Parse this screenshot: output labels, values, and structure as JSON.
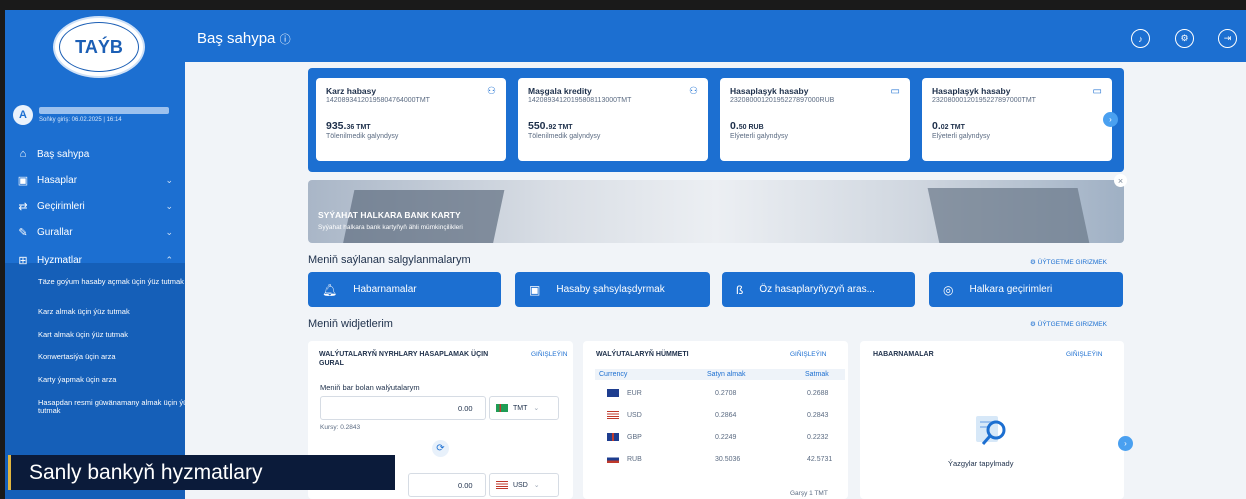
{
  "logo": {
    "text": "TAÝB"
  },
  "user": {
    "avatar_letter": "A",
    "last_login": "Soňky giriş: 06.02.2025 | 16:14"
  },
  "sidebar": {
    "items": [
      {
        "label": "Baş sahypa",
        "icon": "home-icon"
      },
      {
        "label": "Hasaplar",
        "icon": "wallet-icon"
      },
      {
        "label": "Geçirimleri",
        "icon": "transfer-icon"
      },
      {
        "label": "Gurallar",
        "icon": "tools-icon"
      },
      {
        "label": "Hyzmatlar",
        "icon": "grid-icon"
      }
    ],
    "services_submenu": [
      "Täze goýum hasaby açmak üçin ýüz tutmak",
      "Karz almak üçin ýüz tutmak",
      "Kart almak üçin ýüz tutmak",
      "Konwertasiýa üçin arza",
      "Karty ýapmak üçin arza",
      "Hasapdan resmi güwänamany almak üçin ýüz tutmak"
    ]
  },
  "header": {
    "title": "Baş sahypa",
    "icons": [
      "bell-icon",
      "settings-icon",
      "logout-icon"
    ]
  },
  "accounts": [
    {
      "title": "Karz habasy",
      "number": "14208934120195804764000TMT",
      "amount_main": "935.",
      "amount_dec": "36 TMT",
      "subtitle": "Tölenilmedik galyndysy"
    },
    {
      "title": "Maşgala kredity",
      "number": "14208934120195808113000TMT",
      "amount_main": "550.",
      "amount_dec": "92 TMT",
      "subtitle": "Tölenilmedik galyndysy"
    },
    {
      "title": "Hasaplaşyk hasaby",
      "number": "23208000120195227897000RUB",
      "amount_main": "0.",
      "amount_dec": "50 RUB",
      "subtitle": "Elýeterli galyndysy"
    },
    {
      "title": "Hasaplaşyk hasaby",
      "number": "23208000120195227897000TMT",
      "amount_main": "0.",
      "amount_dec": "02 TMT",
      "subtitle": "Elýeterli galyndysy"
    }
  ],
  "banner": {
    "title": "SYÝAHAT HALKARA BANK KARTY",
    "subtitle": "Syýahat halkara bank kartyňyň ähli mümkinçilikleri"
  },
  "favorites": {
    "title": "Meniň saýlanan salgylanmalarym",
    "settings": "ÜÝTGETME GIRIZMEK",
    "buttons": [
      "Habarnamalar",
      "Hasaby şahsylaşdyrmak",
      "Öz hasaplaryňyzyň aras...",
      "Halkara geçirimleri"
    ]
  },
  "widgets": {
    "title": "Meniň widjetlerim",
    "settings": "ÜÝTGETME GIRIZMEK",
    "calculator": {
      "title_line1": "WALÝUTALARYŇ NYRHLARY HASAPLAMAK ÜÇIN",
      "title_line2": "GURAL",
      "link": "GIŇIŞLEÝIN",
      "label": "Meniň bar bolan walýutalarym",
      "amount1": "0.00",
      "currency1": "TMT",
      "rate": "Kursy: 0.2843",
      "amount2": "0.00",
      "currency2": "USD"
    },
    "rates": {
      "title": "WALÝUTALARYŇ HÜMMETI",
      "link": "GIŇIŞLEÝIN",
      "headers": [
        "Currency",
        "Satyn almak",
        "Satmak"
      ],
      "rows": [
        {
          "code": "EUR",
          "buy": "0.2708",
          "sell": "0.2688"
        },
        {
          "code": "USD",
          "buy": "0.2864",
          "sell": "0.2843"
        },
        {
          "code": "GBP",
          "buy": "0.2249",
          "sell": "0.2232"
        },
        {
          "code": "RUB",
          "buy": "30.5036",
          "sell": "42.5731"
        }
      ],
      "footer": "Garşy 1 TMT"
    },
    "notifications": {
      "title": "HABARNAMALAR",
      "link": "GIŇIŞLEÝIN",
      "empty": "Ýazgylar tapylmady"
    }
  },
  "caption": "Sanly bankyň hyzmatlary"
}
